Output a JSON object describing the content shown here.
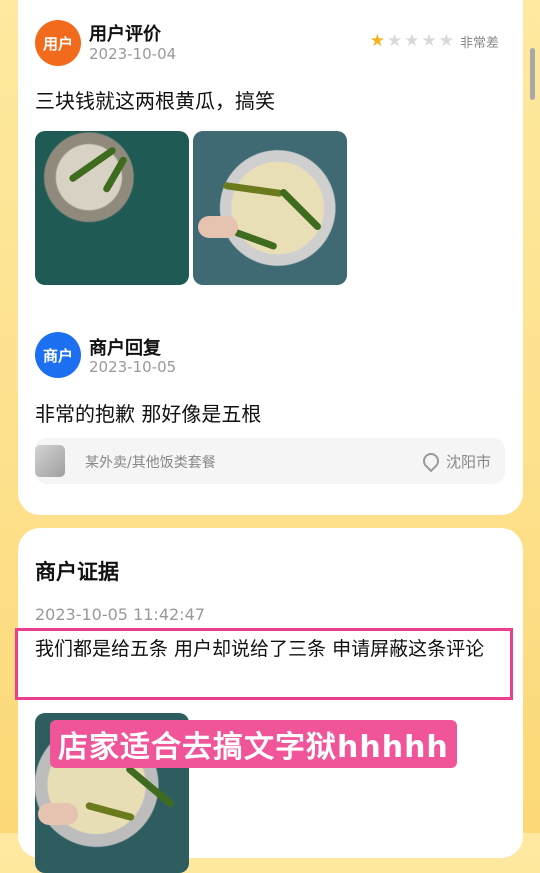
{
  "review": {
    "user_avatar": "用户",
    "user_name": "用户评价",
    "user_date": "2023-10-04",
    "rating": 1,
    "rating_max": 5,
    "rating_text": "非常差",
    "review_text": "三块钱就这两根黄瓜，搞笑",
    "merchant_avatar": "商户",
    "merchant_name": "商户回复",
    "merchant_date": "2023-10-05",
    "reply_text": "非常的抱歉 那好像是五根",
    "tag_text": "某外卖/其他饭类套餐",
    "location": "沈阳市"
  },
  "evidence": {
    "title": "商户证据",
    "datetime": "2023-10-05 11:42:47",
    "text": "我们都是给五条 用户却说给了三条 申请屏蔽这条评论"
  },
  "overlay_caption": "店家适合去搞文字狱hhhhh",
  "colors": {
    "user_avatar": "#f26a1b",
    "merchant_avatar": "#1d6ff2",
    "star_on": "#f6b31b",
    "highlight": "#ec3d8f"
  }
}
